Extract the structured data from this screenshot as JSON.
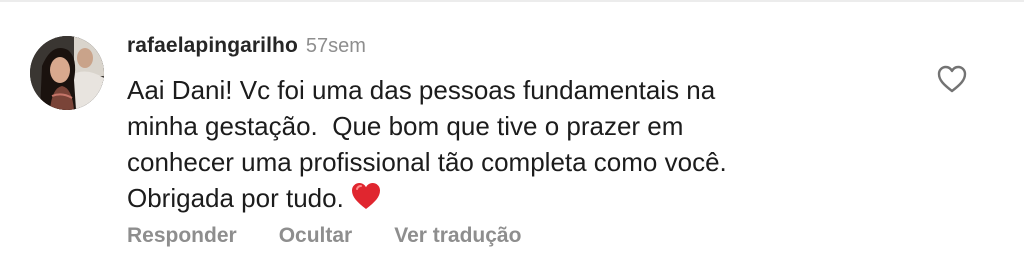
{
  "comment": {
    "username": "rafaelapingarilho",
    "timestamp": "57sem",
    "text": "Aai Dani! Vc foi uma das pessoas fundamentais na\nminha gestação.  Que bom que tive o prazer em\nconhecer uma profissional tão completa como você.\nObrigada por tudo.",
    "emoji_icon": "red-heart-icon",
    "like_icon": "heart-outline-icon",
    "actions": {
      "reply": "Responder",
      "hide": "Ocultar",
      "translate": "Ver tradução"
    }
  },
  "colors": {
    "username": "#262626",
    "secondary": "#8e8e8e",
    "text": "#1c1c1c",
    "heart_emoji": "#e0262f"
  }
}
